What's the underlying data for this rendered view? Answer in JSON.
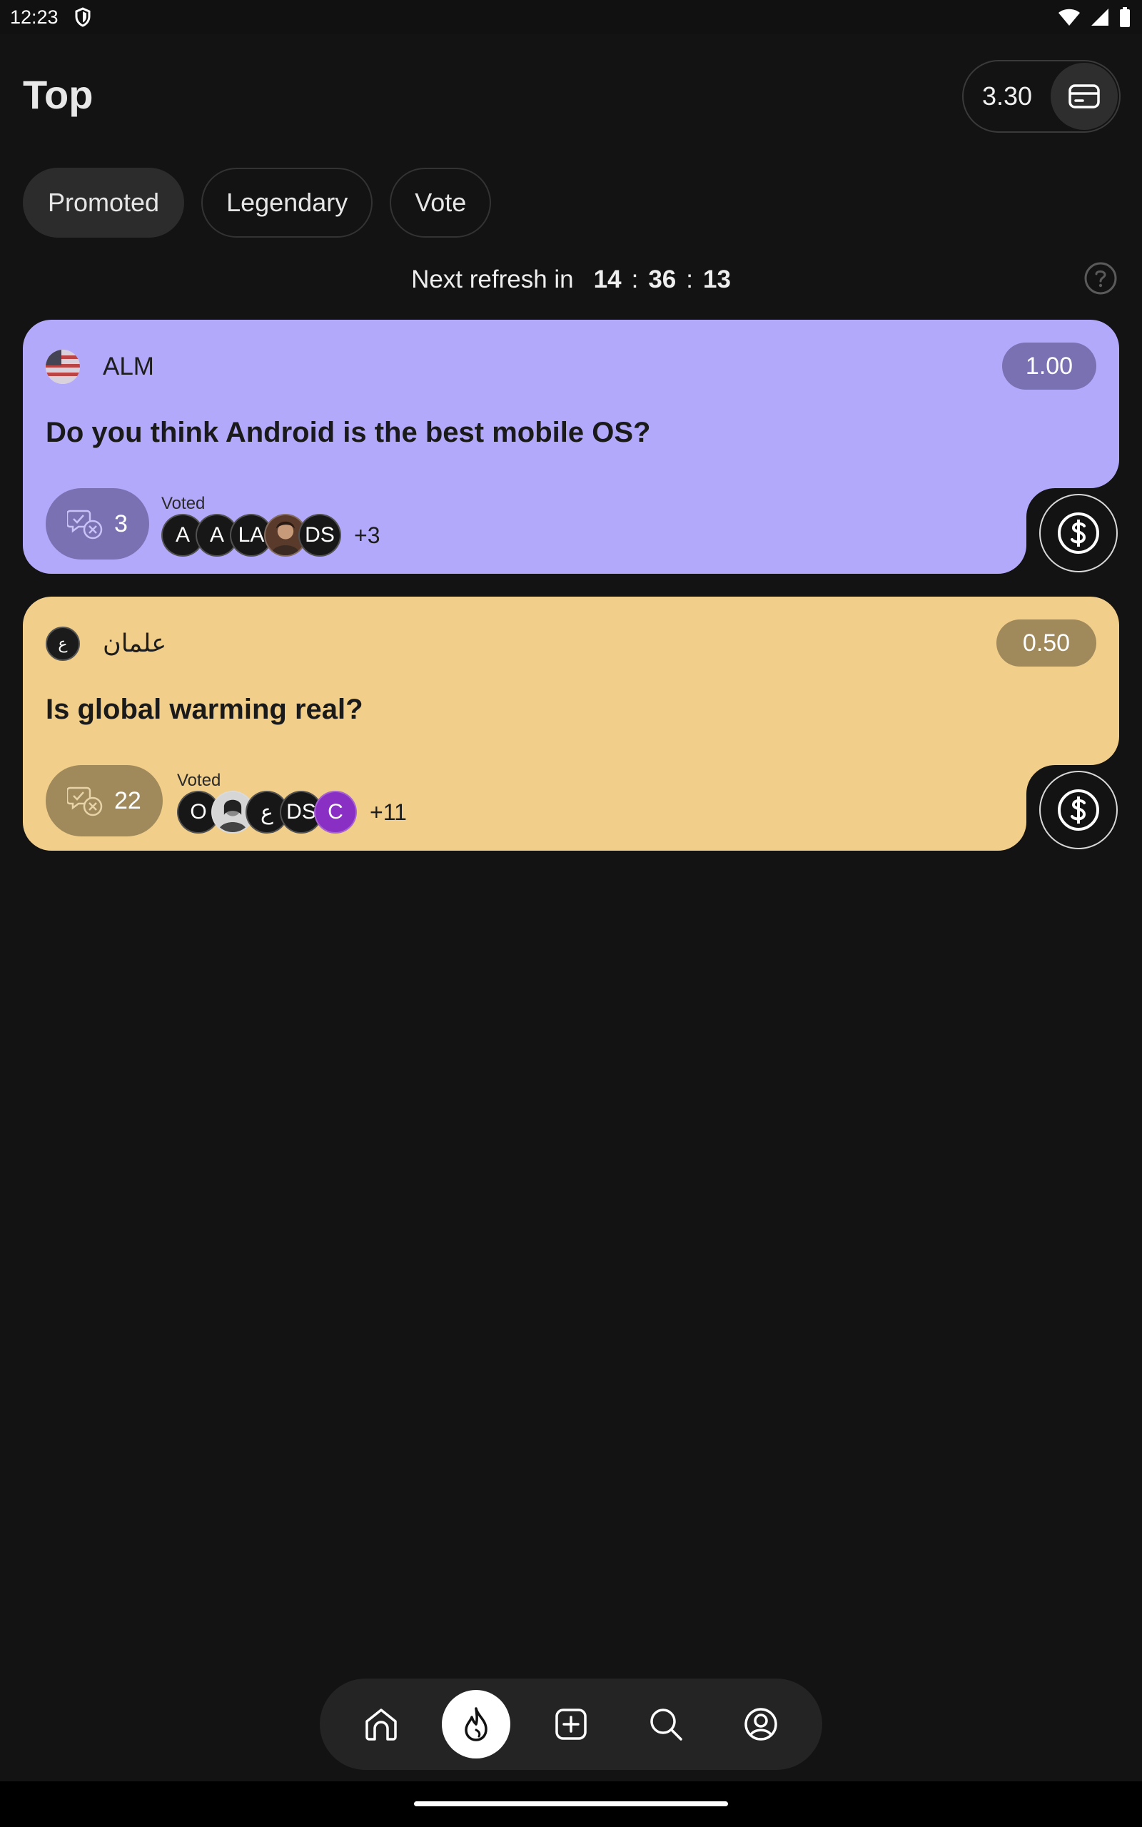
{
  "status_bar": {
    "time": "12:23"
  },
  "header": {
    "title": "Top",
    "balance": "3.30"
  },
  "tabs": [
    {
      "label": "Promoted",
      "active": true
    },
    {
      "label": "Legendary",
      "active": false
    },
    {
      "label": "Vote",
      "active": false
    }
  ],
  "refresh": {
    "label": "Next refresh in",
    "hours": "14",
    "minutes": "36",
    "seconds": "13",
    "separator": ":"
  },
  "cards": [
    {
      "author": "ALM",
      "reward": "1.00",
      "question": "Do you think Android is the best mobile OS?",
      "count": "3",
      "voted_label": "Voted",
      "voters": [
        "A",
        "A",
        "LA",
        "",
        "DS"
      ],
      "more": "+3",
      "color": "#b3a9fb",
      "accent": "#7a71b3"
    },
    {
      "author": "علمان",
      "author_initial": "ع",
      "reward": "0.50",
      "question": "Is global warming real?",
      "count": "22",
      "voted_label": "Voted",
      "voters": [
        "O",
        "",
        "ع",
        "DS",
        "C"
      ],
      "more": "+11",
      "color": "#f1ce8a",
      "accent": "#a08a5c"
    }
  ],
  "nav": [
    "home-icon",
    "flame-icon",
    "plus-icon",
    "search-icon",
    "profile-icon"
  ]
}
